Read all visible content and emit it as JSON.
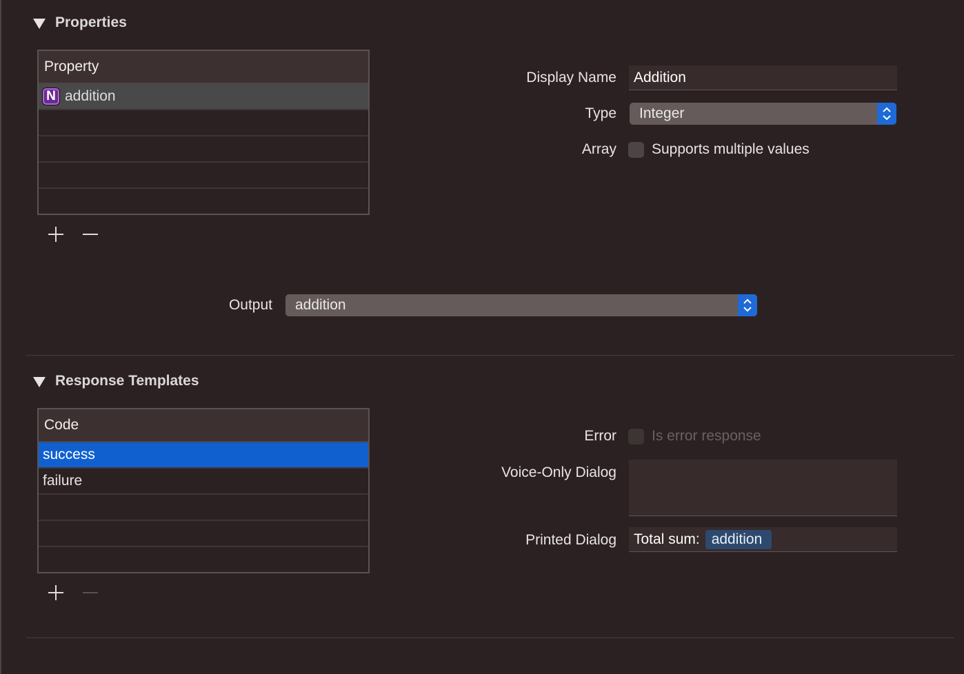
{
  "properties": {
    "title": "Properties",
    "table": {
      "header": "Property",
      "rows": [
        {
          "label": "addition",
          "badge": "N"
        }
      ]
    },
    "display_name": {
      "label": "Display Name",
      "value": "Addition"
    },
    "type": {
      "label": "Type",
      "value": "Integer"
    },
    "array": {
      "label": "Array",
      "checkbox_label": "Supports multiple values",
      "checked": false
    },
    "output": {
      "label": "Output",
      "value": "addition"
    }
  },
  "responses": {
    "title": "Response Templates",
    "table": {
      "header": "Code",
      "rows": [
        "success",
        "failure"
      ]
    },
    "error": {
      "label": "Error",
      "checkbox_label": "Is error response",
      "checked": false,
      "disabled": true
    },
    "voice_dialog": {
      "label": "Voice-Only Dialog",
      "value": ""
    },
    "printed_dialog": {
      "label": "Printed Dialog",
      "text": "Total sum:",
      "token": "addition"
    }
  },
  "colors": {
    "background": "#2c2122",
    "accent": "#1060d0",
    "badge": "#6b2c8f",
    "token": "#2d4a6e"
  }
}
